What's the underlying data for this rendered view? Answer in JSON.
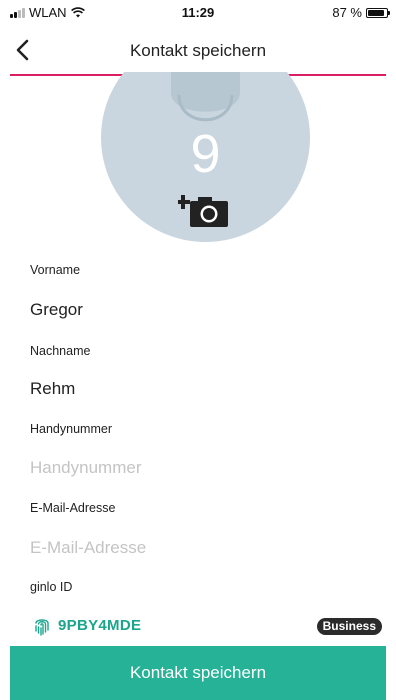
{
  "status_bar": {
    "network": "WLAN",
    "time": "11:29",
    "battery": "87 %",
    "battery_level": 0.87
  },
  "nav": {
    "title": "Kontakt speichern",
    "back_icon": "chevron-left-icon",
    "accent_color": "#d91e63"
  },
  "avatar": {
    "initial": "9",
    "camera_icon": "add-photo-icon"
  },
  "form": {
    "first_name": {
      "label": "Vorname",
      "value": "Gregor",
      "placeholder": ""
    },
    "last_name": {
      "label": "Nachname",
      "value": "Rehm",
      "placeholder": ""
    },
    "phone": {
      "label": "Handynummer",
      "value": "",
      "placeholder": "Handynummer"
    },
    "email": {
      "label": "E-Mail-Adresse",
      "value": "",
      "placeholder": "E-Mail-Adresse"
    },
    "ginlo": {
      "label": "ginlo ID",
      "value": "9PBY4MDE",
      "badge": "Business",
      "icon": "fingerprint-icon",
      "color": "#1aa58c"
    }
  },
  "save_button": {
    "label": "Kontakt speichern",
    "color": "#25b296"
  }
}
